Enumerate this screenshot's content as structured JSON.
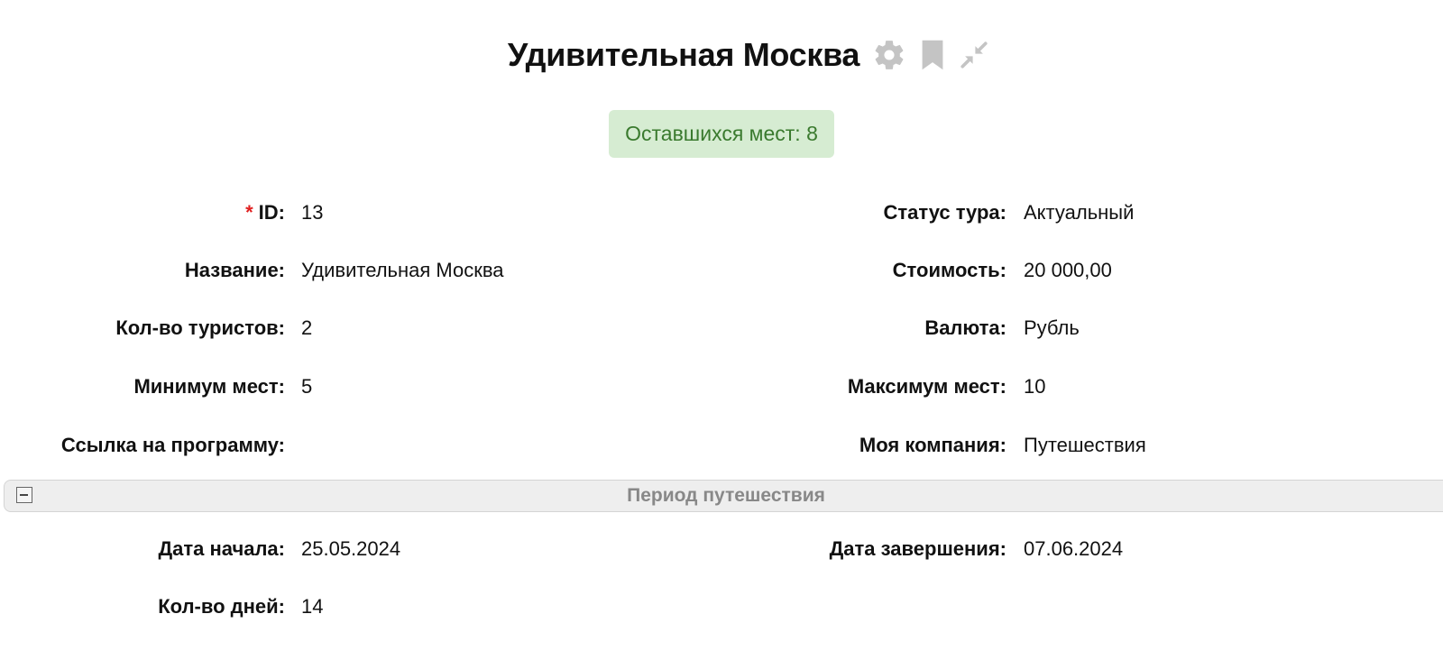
{
  "header": {
    "title": "Удивительная Москва",
    "icons": [
      "gear-icon",
      "bookmark-icon",
      "collapse-arrows-icon"
    ],
    "icon_color": "#c4c4c4"
  },
  "badge": {
    "text": "Оставшихся мест: 8",
    "bg_color": "#d6ecd2",
    "text_color": "#3a7a2e"
  },
  "fields": {
    "id": {
      "label": "ID:",
      "value": "13",
      "required_mark": "*"
    },
    "tour_status": {
      "label": "Статус тура:",
      "value": "Актуальный"
    },
    "name": {
      "label": "Название:",
      "value": "Удивительная Москва"
    },
    "cost": {
      "label": "Стоимость:",
      "value": "20 000,00"
    },
    "tourists_count": {
      "label": "Кол-во туристов:",
      "value": "2"
    },
    "currency": {
      "label": "Валюта:",
      "value": "Рубль"
    },
    "min_seats": {
      "label": "Минимум мест:",
      "value": "5"
    },
    "max_seats": {
      "label": "Максимум мест:",
      "value": "10"
    },
    "program_link": {
      "label": "Ссылка на программу:",
      "value": ""
    },
    "my_company": {
      "label": "Моя компания:",
      "value": "Путешествия"
    }
  },
  "travel_period": {
    "title": "Период путешествия",
    "start_date": {
      "label": "Дата начала:",
      "value": "25.05.2024"
    },
    "end_date": {
      "label": "Дата завершения:",
      "value": "07.06.2024"
    },
    "days_count": {
      "label": "Кол-во дней:",
      "value": "14"
    }
  }
}
